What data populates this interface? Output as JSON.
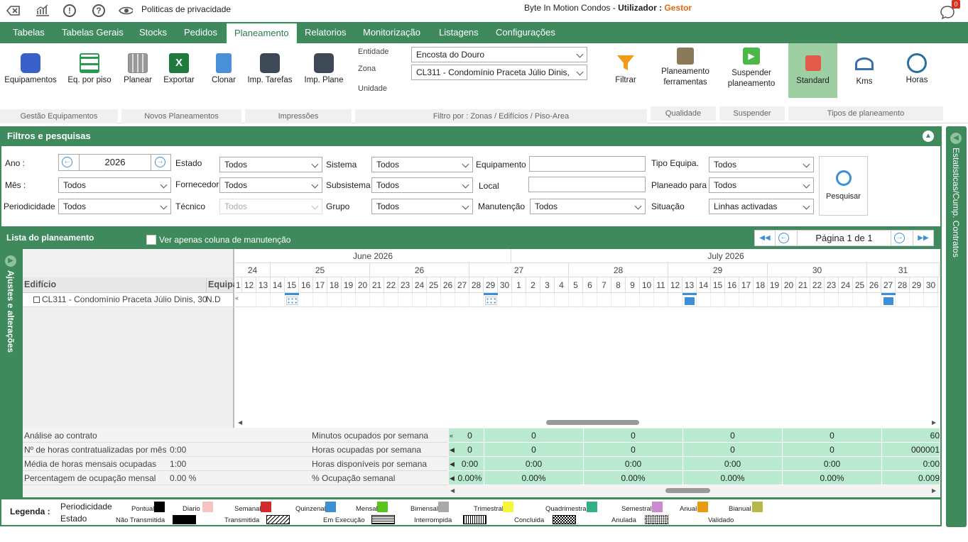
{
  "topbar": {
    "privacy": "Politicas de privacidade",
    "app_title": "Byte In Motion Condos - ",
    "user_label": "Utilizador : ",
    "user_role": "Gestor",
    "notif_count": "0"
  },
  "menu": [
    "Tabelas",
    "Tabelas Gerais",
    "Stocks",
    "Pedidos",
    "Planeamento",
    "Relatorios",
    "Monitorização",
    "Listagens",
    "Configurações"
  ],
  "ribbon": {
    "buttons": [
      "Equipamentos",
      "Eq. por piso",
      "Planear",
      "Exportar",
      "Clonar",
      "Imp. Tarefas",
      "Imp. Plane"
    ],
    "entidade_label": "Entidade",
    "entidade_value": "Encosta do Douro",
    "zona_label": "Zona",
    "zona_value": "CL311 - Condomínio Praceta Júlio Dinis,",
    "unidade_label": "Unidade",
    "filtrar": "Filtrar",
    "plan_ferr_1": "Planeamento",
    "plan_ferr_2": "ferramentas",
    "suspender_1": "Suspender",
    "suspender_2": "planeamento",
    "standard": "Standard",
    "kms": "Kms",
    "horas": "Horas",
    "groups": [
      "Gestão Equipamentos",
      "Novos Planeamentos",
      "Impressões",
      "Filtro por : Zonas / Edifícios / Piso-Area",
      "Qualidade",
      "Suspender",
      "Tipos de planeamento"
    ]
  },
  "filters": {
    "title": "Filtros e pesquisas",
    "ano_label": "Ano :",
    "ano_value": "2026",
    "mes_label": "Mês :",
    "mes_value": "Todos",
    "periodicidade_label": "Periodicidade",
    "periodicidade_value": "Todos",
    "estado_label": "Estado",
    "estado_value": "Todos",
    "fornecedor_label": "Fornecedor",
    "fornecedor_value": "Todos",
    "tecnico_label": "Técnico",
    "tecnico_value": "Todos",
    "sistema_label": "Sistema",
    "sistema_value": "Todos",
    "subsistema_label": "Subsistema",
    "subsistema_value": "Todos",
    "grupo_label": "Grupo",
    "grupo_value": "Todos",
    "equipamento_label": "Equipamento",
    "local_label": "Local",
    "manutencao_label": "Manutenção",
    "manutencao_value": "Todos",
    "tipo_label": "Tipo Equipa.",
    "tipo_value": "Todos",
    "planeado_label": "Planeado para",
    "planeado_value": "Todos",
    "situacao_label": "Situação",
    "situacao_value": "Linhas activadas",
    "pesquisar": "Pesquisar"
  },
  "grid": {
    "title": "Lista do planeamento",
    "checkbox_label": "Ver apenas coluna de manutenção",
    "page": "Página 1 de 1",
    "month1": "June 2026",
    "month2": "July 2026",
    "weeks": [
      "24",
      "25",
      "26",
      "27",
      "28",
      "29",
      "30",
      "31"
    ],
    "days": [
      "12",
      "13",
      "14",
      "15",
      "16",
      "17",
      "18",
      "19",
      "20",
      "21",
      "22",
      "23",
      "24",
      "25",
      "26",
      "27",
      "28",
      "29",
      "30",
      "1",
      "2",
      "3",
      "4",
      "5",
      "6",
      "7",
      "8",
      "9",
      "10",
      "11",
      "12",
      "13",
      "14",
      "15",
      "16",
      "17",
      "18",
      "19",
      "20",
      "21",
      "22",
      "23",
      "24",
      "25",
      "26",
      "27",
      "28",
      "29",
      "30"
    ],
    "col_edificio": "Edifício",
    "col_equipa": "Equipa",
    "col_1": "1",
    "row_building": "CL311 - Condomínio Praceta Júlio Dinis, 30",
    "row_equip": "N.D",
    "side_left": "Ajustes e alterações",
    "side_right": "Estatisticas/Cump. Contratos"
  },
  "stats": {
    "rows": [
      {
        "label": "Análise ao contrato",
        "value": "",
        "label2": "Minutos ocupados por semana"
      },
      {
        "label": "Nº de horas contratualizadas por mês",
        "value": "0:00",
        "label2": "Horas ocupadas por semana"
      },
      {
        "label": "Média de horas mensais ocupadas",
        "value": "1:00",
        "label2": "Horas disponíveis por semana"
      },
      {
        "label": "Percentagem de ocupação mensal",
        "value": "0.00 %",
        "label2": "% Ocupação semanal"
      }
    ],
    "green": [
      [
        "0",
        "0",
        "0",
        "0",
        "0",
        "60"
      ],
      [
        "0",
        "0",
        "0",
        "0",
        "0",
        "000001"
      ],
      [
        "0:00",
        "0:00",
        "0:00",
        "0:00",
        "0:00",
        "0:00"
      ],
      [
        "0.00%",
        "0.00%",
        "0.00%",
        "0.00%",
        "0.00%",
        "0.009"
      ]
    ]
  },
  "legend": {
    "title": "Legenda :",
    "periodicidade": "Periodicidade",
    "estado": "Estado",
    "items1": [
      "Pontual",
      "Diario",
      "Semanal",
      "Quinzenal",
      "Mensal",
      "Bimensal",
      "Trimestral",
      "Quadrimestral",
      "Semestral",
      "Anual",
      "Bianual"
    ],
    "colors1": [
      "#000000",
      "#f6c2c2",
      "#d42a2a",
      "#3d8fd6",
      "#5cc21c",
      "#aaaaaa",
      "#f5f53a",
      "#33b08a",
      "#c98ad0",
      "#e89a10",
      "#b6b84a"
    ],
    "items2": [
      "Não Transmitida",
      "Transmitida",
      "Em Execução",
      "Interrompida",
      "Concluida",
      "Anulada",
      "Validado"
    ]
  }
}
